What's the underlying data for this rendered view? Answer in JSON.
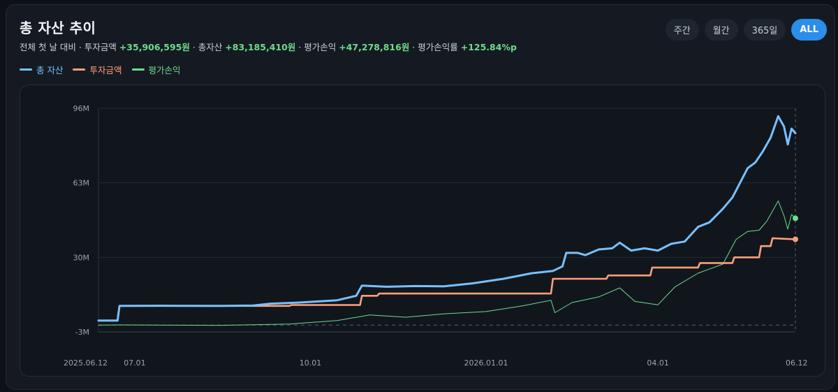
{
  "header": {
    "title": "총 자산 추이",
    "subtitle": {
      "prefix": "전체 첫 날 대비 · 투자금액 ",
      "invest_delta": "+35,906,595원",
      "sep1": " · 총자산 ",
      "total_value": "+83,185,410원",
      "sep2": " · 평가손익 ",
      "pnl_value": "+47,278,816원",
      "sep3": " · 평가손익률 ",
      "pnl_rate": "+125.84%p"
    }
  },
  "range_buttons": [
    {
      "label": "주간",
      "active": false
    },
    {
      "label": "월간",
      "active": false
    },
    {
      "label": "365일",
      "active": false
    },
    {
      "label": "ALL",
      "active": true
    }
  ],
  "legend": [
    {
      "label": "총 자산",
      "color": "#79c0ff"
    },
    {
      "label": "투자금액",
      "color": "#ffa07a"
    },
    {
      "label": "평가손익",
      "color": "#6fdc8c"
    }
  ],
  "chart_data": {
    "type": "line",
    "title": "",
    "xlabel": "",
    "ylabel": "",
    "unit": "M",
    "ylim": [
      -3,
      96
    ],
    "y_ticks": [
      96,
      63,
      30,
      -3
    ],
    "y_tick_labels": [
      "96M",
      "63M",
      "30M",
      "-3M"
    ],
    "xlim": [
      "2025-06-12",
      "2026-06-12"
    ],
    "x_ticks": [
      "2025-06-12",
      "2025-07-01",
      "2025-10-01",
      "2026-01-01",
      "2026-04-01",
      "2026-06-12"
    ],
    "x_tick_labels": [
      "2025.06.12",
      "07.01",
      "10.01",
      "2026.01.01",
      "04.01",
      "06.12"
    ],
    "zero_line": true,
    "series": [
      {
        "name": "총 자산",
        "color": "#79c0ff",
        "points": [
          [
            "2025-06-12",
            2.0
          ],
          [
            "2025-06-22",
            2.0
          ],
          [
            "2025-06-23",
            8.5
          ],
          [
            "2025-07-15",
            8.6
          ],
          [
            "2025-08-15",
            8.5
          ],
          [
            "2025-09-01",
            8.7
          ],
          [
            "2025-09-10",
            9.5
          ],
          [
            "2025-09-25",
            10.0
          ],
          [
            "2025-10-15",
            11.0
          ],
          [
            "2025-10-25",
            13.0
          ],
          [
            "2025-10-28",
            17.5
          ],
          [
            "2025-11-10",
            17.0
          ],
          [
            "2025-11-25",
            17.3
          ],
          [
            "2025-12-10",
            17.2
          ],
          [
            "2025-12-25",
            18.5
          ],
          [
            "2026-01-10",
            20.5
          ],
          [
            "2026-01-25",
            23.0
          ],
          [
            "2026-02-05",
            24.0
          ],
          [
            "2026-02-10",
            26.0
          ],
          [
            "2026-02-12",
            32.0
          ],
          [
            "2026-02-18",
            32.0
          ],
          [
            "2026-02-22",
            31.0
          ],
          [
            "2026-03-01",
            33.5
          ],
          [
            "2026-03-08",
            34.0
          ],
          [
            "2026-03-12",
            36.5
          ],
          [
            "2026-03-18",
            33.0
          ],
          [
            "2026-03-25",
            34.0
          ],
          [
            "2026-04-01",
            33.0
          ],
          [
            "2026-04-08",
            36.0
          ],
          [
            "2026-04-15",
            37.0
          ],
          [
            "2026-04-22",
            43.5
          ],
          [
            "2026-04-28",
            45.5
          ],
          [
            "2026-05-05",
            51.5
          ],
          [
            "2026-05-10",
            56.5
          ],
          [
            "2026-05-14",
            63.0
          ],
          [
            "2026-05-18",
            69.5
          ],
          [
            "2026-05-22",
            72.0
          ],
          [
            "2026-05-26",
            77.0
          ],
          [
            "2026-05-30",
            83.0
          ],
          [
            "2026-06-03",
            92.5
          ],
          [
            "2026-06-06",
            88.0
          ],
          [
            "2026-06-08",
            80.0
          ],
          [
            "2026-06-10",
            87.0
          ],
          [
            "2026-06-12",
            85.0
          ]
        ]
      },
      {
        "name": "투자금액",
        "color": "#ffa07a",
        "points": [
          [
            "2025-06-12",
            2.0
          ],
          [
            "2025-06-22",
            2.0
          ],
          [
            "2025-06-23",
            8.5
          ],
          [
            "2025-09-20",
            8.5
          ],
          [
            "2025-09-21",
            8.9
          ],
          [
            "2025-10-27",
            8.9
          ],
          [
            "2025-10-28",
            13.0
          ],
          [
            "2025-11-05",
            13.0
          ],
          [
            "2025-11-06",
            14.0
          ],
          [
            "2026-02-04",
            14.0
          ],
          [
            "2026-02-05",
            20.5
          ],
          [
            "2026-03-05",
            20.5
          ],
          [
            "2026-03-06",
            22.0
          ],
          [
            "2026-03-28",
            22.0
          ],
          [
            "2026-03-29",
            25.5
          ],
          [
            "2026-04-22",
            25.5
          ],
          [
            "2026-04-23",
            27.5
          ],
          [
            "2026-05-10",
            27.5
          ],
          [
            "2026-05-11",
            30.0
          ],
          [
            "2026-05-24",
            30.0
          ],
          [
            "2026-05-25",
            35.0
          ],
          [
            "2026-05-30",
            35.0
          ],
          [
            "2026-05-31",
            38.5
          ],
          [
            "2026-06-12",
            38.0
          ]
        ]
      },
      {
        "name": "평가손익",
        "color": "#6fdc8c",
        "points": [
          [
            "2025-06-12",
            0.0
          ],
          [
            "2025-06-23",
            0.1
          ],
          [
            "2025-08-15",
            -0.1
          ],
          [
            "2025-09-20",
            0.5
          ],
          [
            "2025-10-15",
            2.0
          ],
          [
            "2025-11-01",
            4.5
          ],
          [
            "2025-11-20",
            3.5
          ],
          [
            "2025-12-10",
            5.0
          ],
          [
            "2026-01-01",
            6.0
          ],
          [
            "2026-01-20",
            8.5
          ],
          [
            "2026-02-04",
            11.0
          ],
          [
            "2026-02-06",
            5.5
          ],
          [
            "2026-02-15",
            10.0
          ],
          [
            "2026-03-01",
            12.5
          ],
          [
            "2026-03-12",
            16.5
          ],
          [
            "2026-03-20",
            10.5
          ],
          [
            "2026-04-01",
            9.0
          ],
          [
            "2026-04-10",
            17.0
          ],
          [
            "2026-04-22",
            23.0
          ],
          [
            "2026-05-05",
            27.0
          ],
          [
            "2026-05-12",
            38.0
          ],
          [
            "2026-05-18",
            41.5
          ],
          [
            "2026-05-24",
            42.0
          ],
          [
            "2026-05-28",
            46.0
          ],
          [
            "2026-06-03",
            55.0
          ],
          [
            "2026-06-06",
            48.5
          ],
          [
            "2026-06-08",
            42.5
          ],
          [
            "2026-06-10",
            49.0
          ],
          [
            "2026-06-12",
            47.3
          ]
        ]
      }
    ]
  }
}
